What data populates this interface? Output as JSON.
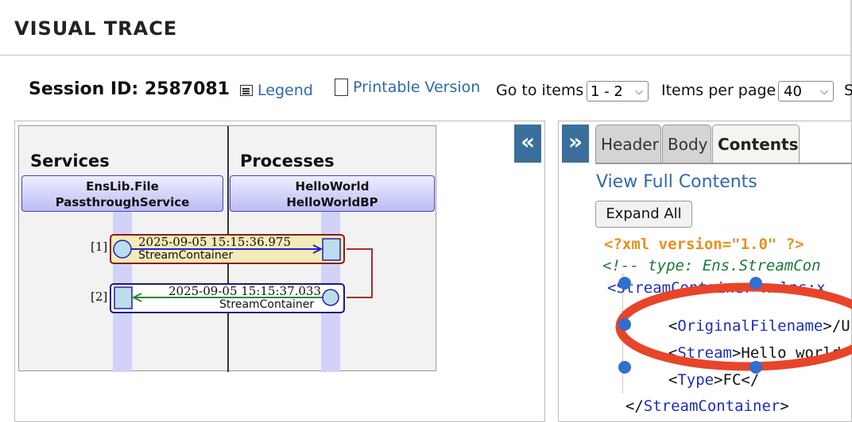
{
  "header": {
    "title": "VISUAL TRACE"
  },
  "toolbar": {
    "session_id": "Session ID: 2587081",
    "legend": "Legend",
    "printable": "Printable Version",
    "goto_label": "Go to items",
    "goto_value": "1 - 2",
    "ipp_label": "Items per page",
    "ipp_value": "40",
    "cut_text": "S"
  },
  "diagram": {
    "columns": [
      {
        "title": "Services",
        "actor_line1": "EnsLib.File",
        "actor_line2": "PassthroughService"
      },
      {
        "title": "Processes",
        "actor_line1": "HelloWorld",
        "actor_line2": "HelloWorldBP"
      }
    ],
    "messages": [
      {
        "index": "[1]",
        "time": "2025-09-05 15:15:36.975",
        "type": "StreamContainer",
        "color": "#8b1a1a",
        "fill": "#f5eab8",
        "arrow": "#2222cc"
      },
      {
        "index": "[2]",
        "time": "2025-09-05 15:15:37.033",
        "type": "StreamContainer",
        "color": "#1a1a7a",
        "fill": "#ffffff",
        "arrow": "#2a8a2a"
      }
    ]
  },
  "buttons": {
    "collapse": "«",
    "expand": "»"
  },
  "tabs": [
    {
      "label": "Header"
    },
    {
      "label": "Body"
    },
    {
      "label": "Contents"
    }
  ],
  "contents": {
    "view_full": "View Full Contents",
    "expand_all": "Expand All",
    "xml_decl": "<?xml version=\"1.0\" ?>",
    "comment": "<!-- type: Ens.StreamCon",
    "root_open": "<StreamContainer xmlns:x",
    "line_filename_tag": "OriginalFilename",
    "line_filename_rest": ">/U",
    "line_stream_tag": "Stream",
    "line_stream_text": ">Hello world",
    "line_type_tag": "Type",
    "line_type_text": ">FC</",
    "root_close_tag": "StreamContainer"
  },
  "colors": {
    "accent": "#3a6f9c",
    "link": "#2f6aa8",
    "annotation": "#e8442a",
    "handle": "#2f6fd0"
  }
}
